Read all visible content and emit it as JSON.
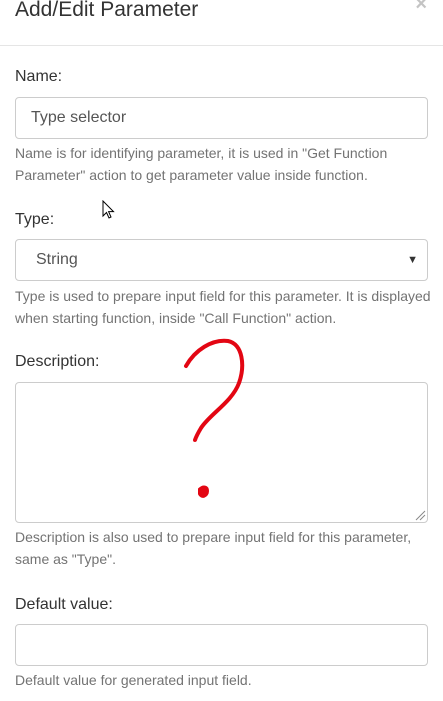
{
  "dialog": {
    "title": "Add/Edit Parameter",
    "close_symbol": "×"
  },
  "fields": {
    "name": {
      "label": "Name:",
      "value": "Type selector",
      "help": "Name is for identifying parameter, it is used in \"Get Function Parameter\" action to get parameter value inside function."
    },
    "type": {
      "label": "Type:",
      "selected": "String",
      "caret": "▼",
      "help": "Type is used to prepare input field for this parameter. It is displayed when starting function, inside \"Call Function\" action."
    },
    "description": {
      "label": "Description:",
      "value": "",
      "help": "Description is also used to prepare input field for this parameter, same as \"Type\"."
    },
    "default_value": {
      "label": "Default value:",
      "value": "",
      "help": "Default value for generated input field."
    }
  },
  "annotation": {
    "icon": "hand-drawn-question-mark-icon",
    "color": "#e30613"
  },
  "colors": {
    "text": "#333333",
    "help_text": "#737373",
    "border": "#cccccc"
  }
}
